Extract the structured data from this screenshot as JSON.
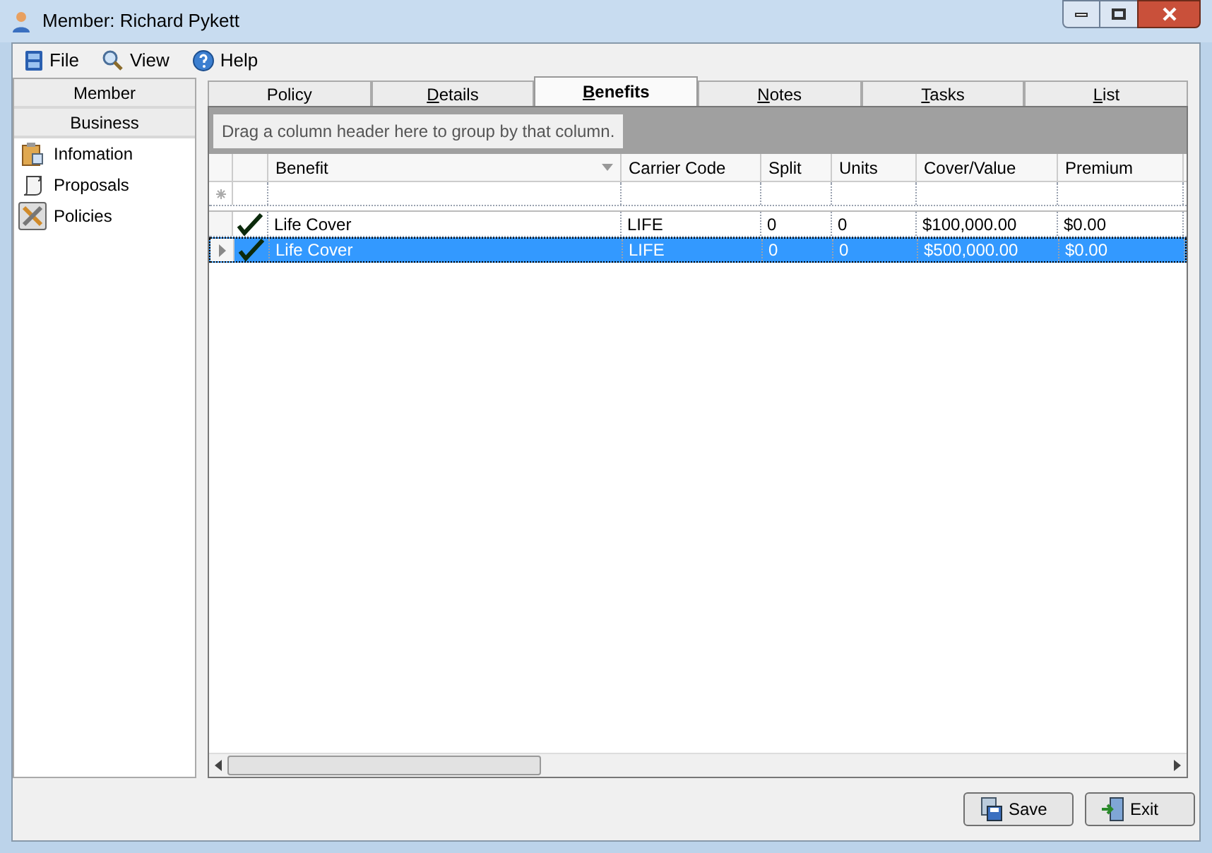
{
  "window": {
    "title": "Member: Richard Pykett"
  },
  "menu": [
    {
      "label": "File",
      "kind": "file"
    },
    {
      "label": "View",
      "kind": "view"
    },
    {
      "label": "Help",
      "kind": "help"
    }
  ],
  "sidebar": {
    "sections": [
      {
        "label": "Member"
      },
      {
        "label": "Business"
      }
    ],
    "items": [
      {
        "label": "Infomation",
        "kind": "info",
        "selected": false
      },
      {
        "label": "Proposals",
        "kind": "proposals",
        "selected": false
      },
      {
        "label": "Policies",
        "kind": "policies",
        "selected": true
      }
    ]
  },
  "tabs": [
    {
      "label": "Policy",
      "selected": false,
      "underlined_first": false
    },
    {
      "label": "Details",
      "selected": false,
      "underlined_first": true
    },
    {
      "label": "Benefits",
      "selected": true,
      "underlined_first": true
    },
    {
      "label": "Notes",
      "selected": false,
      "underlined_first": true
    },
    {
      "label": "Tasks",
      "selected": false,
      "underlined_first": true
    },
    {
      "label": "List",
      "selected": false,
      "underlined_first": true
    }
  ],
  "grid": {
    "group_hint": "Drag a column header here to group by that column.",
    "columns": [
      "Benefit",
      "Carrier Code",
      "Split",
      "Units",
      "Cover/Value",
      "Premium"
    ],
    "rows": [
      {
        "checked": true,
        "selected": false,
        "cells": [
          "Life Cover",
          "LIFE",
          "0",
          "0",
          "$100,000.00",
          "$0.00"
        ]
      },
      {
        "checked": true,
        "selected": true,
        "cells": [
          "Life Cover",
          "LIFE",
          "0",
          "0",
          "$500,000.00",
          "$0.00"
        ]
      }
    ]
  },
  "buttons": [
    {
      "label": "Save",
      "kind": "save"
    },
    {
      "label": "Exit",
      "kind": "exit"
    }
  ]
}
